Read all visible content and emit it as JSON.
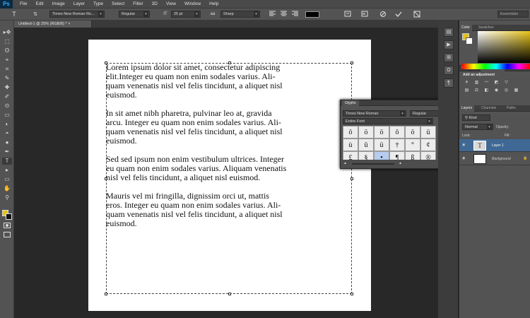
{
  "app": {
    "logo": "Ps"
  },
  "menu": [
    "File",
    "Edit",
    "Image",
    "Layer",
    "Type",
    "Select",
    "Filter",
    "3D",
    "View",
    "Window",
    "Help"
  ],
  "options": {
    "tool_icon": "T",
    "orient_icon": "⇅",
    "font_family": "Times New Roman Ro...",
    "font_style": "Regular",
    "font_size_icon": "tT",
    "font_size": "25 pt",
    "aa_label": "aa",
    "anti_alias": "Sharp",
    "text_color": "#000000",
    "essentials": "Essentials"
  },
  "document": {
    "tab_title": "Untitled-1 @ 25% (RGB/8) *",
    "paragraphs": [
      "Lorem ipsum dolor sit amet, consectetur adipiscing\nelit.Integer eu quam non enim sodales varius. Ali-\nquam venenatis nisl vel felis tincidunt, a aliquet nisl\neuismod.",
      "In sit amet nibh pharetra, pulvinar leo at, gravida\narcu. Integer eu quam non enim sodales varius. Ali-\nquam venenatis nisl vel felis tincidunt, a aliquet nisl\neuismod.",
      "Sed sed ipsum non enim vestibulum ultrices. Integer\neu quam non enim sodales varius. Aliquam venenatis\nnisl vel felis tincidunt, a aliquet nisl euismod.",
      "Mauris vel mi fringilla, dignissim orci ut, mattis\neros. Integer eu quam non enim sodales varius. Ali-\nquam venenatis nisl vel felis tincidunt, a aliquet nisl\neuismod."
    ]
  },
  "tools": [
    "▸✥",
    "⬚",
    "ʘ",
    "⌖",
    "⌗",
    "✎",
    "✚",
    "✐",
    "⊙",
    "▭",
    "◐",
    "◓",
    "●",
    "✒",
    "T",
    "▸",
    "▭",
    "✋",
    "⚲"
  ],
  "colors": {
    "foreground": "#e6c117",
    "background": "#111111"
  },
  "glyphs_panel": {
    "title": "Glyphs",
    "font": "Times New Roman",
    "style": "Regular",
    "show": "Entire Font",
    "rows": [
      [
        "ô",
        "ö",
        "ö",
        "ô",
        "ö",
        "ü"
      ],
      [
        "ù",
        "û",
        "ü",
        "†",
        "°",
        "¢"
      ],
      [
        "£",
        "§",
        "•",
        "¶",
        "ß",
        "®"
      ]
    ],
    "selected": "•"
  },
  "right_panels": {
    "color_tabs": [
      "Color",
      "Swatches"
    ],
    "adjust_tabs": [
      "Libraries",
      "Adjustments",
      "Styles"
    ],
    "add_adjustment": "Add an adjustment",
    "layers_tabs": [
      "Layers",
      "Channels",
      "Paths"
    ],
    "kind_label": "Kind",
    "blend_mode": "Normal",
    "opacity_label": "Opacity:",
    "lock_label": "Lock:",
    "fill_label": "Fill:",
    "layers": [
      "Layer 1",
      "Background"
    ]
  }
}
